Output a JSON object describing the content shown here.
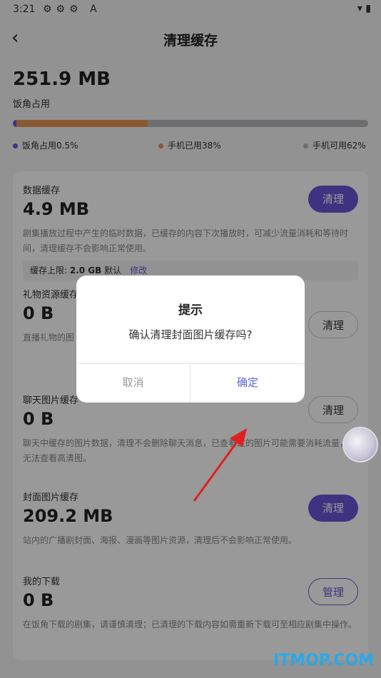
{
  "status_bar": {
    "time": "3:21",
    "icons": "⚙⚙⚙ A",
    "right": "▾ ▮"
  },
  "nav": {
    "back": "‹",
    "title": "清理缓存"
  },
  "summary": {
    "total": "251.9 MB",
    "label": "饭角占用",
    "usage": {
      "app_fraction": 0.005,
      "used_fraction": 0.38,
      "free_fraction": 0.62
    },
    "legend": [
      {
        "label": "饭角占用0.5%",
        "color": "#6a56d8"
      },
      {
        "label": "手机已用38%",
        "color": "#e49453"
      },
      {
        "label": "手机可用62%",
        "color": "#b7b7bd"
      }
    ]
  },
  "sections": {
    "data": {
      "title": "数据缓存",
      "size": "4.9 MB",
      "button": "清理",
      "desc": "剧集播放过程中产生的临时数据，已缓存的内容下次播放时，可减少流量消耗和等待时间，清理缓存不会影响正常使用。",
      "limit_label": "缓存上限: ",
      "limit_value": "2.0 GB",
      "limit_suffix": " 默认",
      "limit_edit": "修改"
    },
    "gift": {
      "title": "礼物资源缓存",
      "size": "0 B",
      "button": "清理",
      "desc": "直播礼物的图"
    },
    "chat": {
      "title": "聊天图片缓存",
      "size": "0 B",
      "button": "清理",
      "desc": "聊天中缓存的图片数据，清理不会删除聊天消息，已查看过的图片可能需要消耗流量，或无法查看高清图。"
    },
    "cover": {
      "title": "封面图片缓存",
      "size": "209.2 MB",
      "button": "清理",
      "desc": "站内的广播剧封面、海报、漫画等图片资源，清理后不会影响正常使用。"
    },
    "download": {
      "title": "我的下载",
      "size": "0 B",
      "button": "管理",
      "desc": "在饭角下载的剧集，请谨慎清理；已清理的下载内容如需重新下载可至相应剧集中操作。"
    }
  },
  "dialog": {
    "title": "提示",
    "message": "确认清理封面图片缓存吗?",
    "cancel": "取消",
    "confirm": "确定"
  },
  "watermark": "ITMOP.COM"
}
